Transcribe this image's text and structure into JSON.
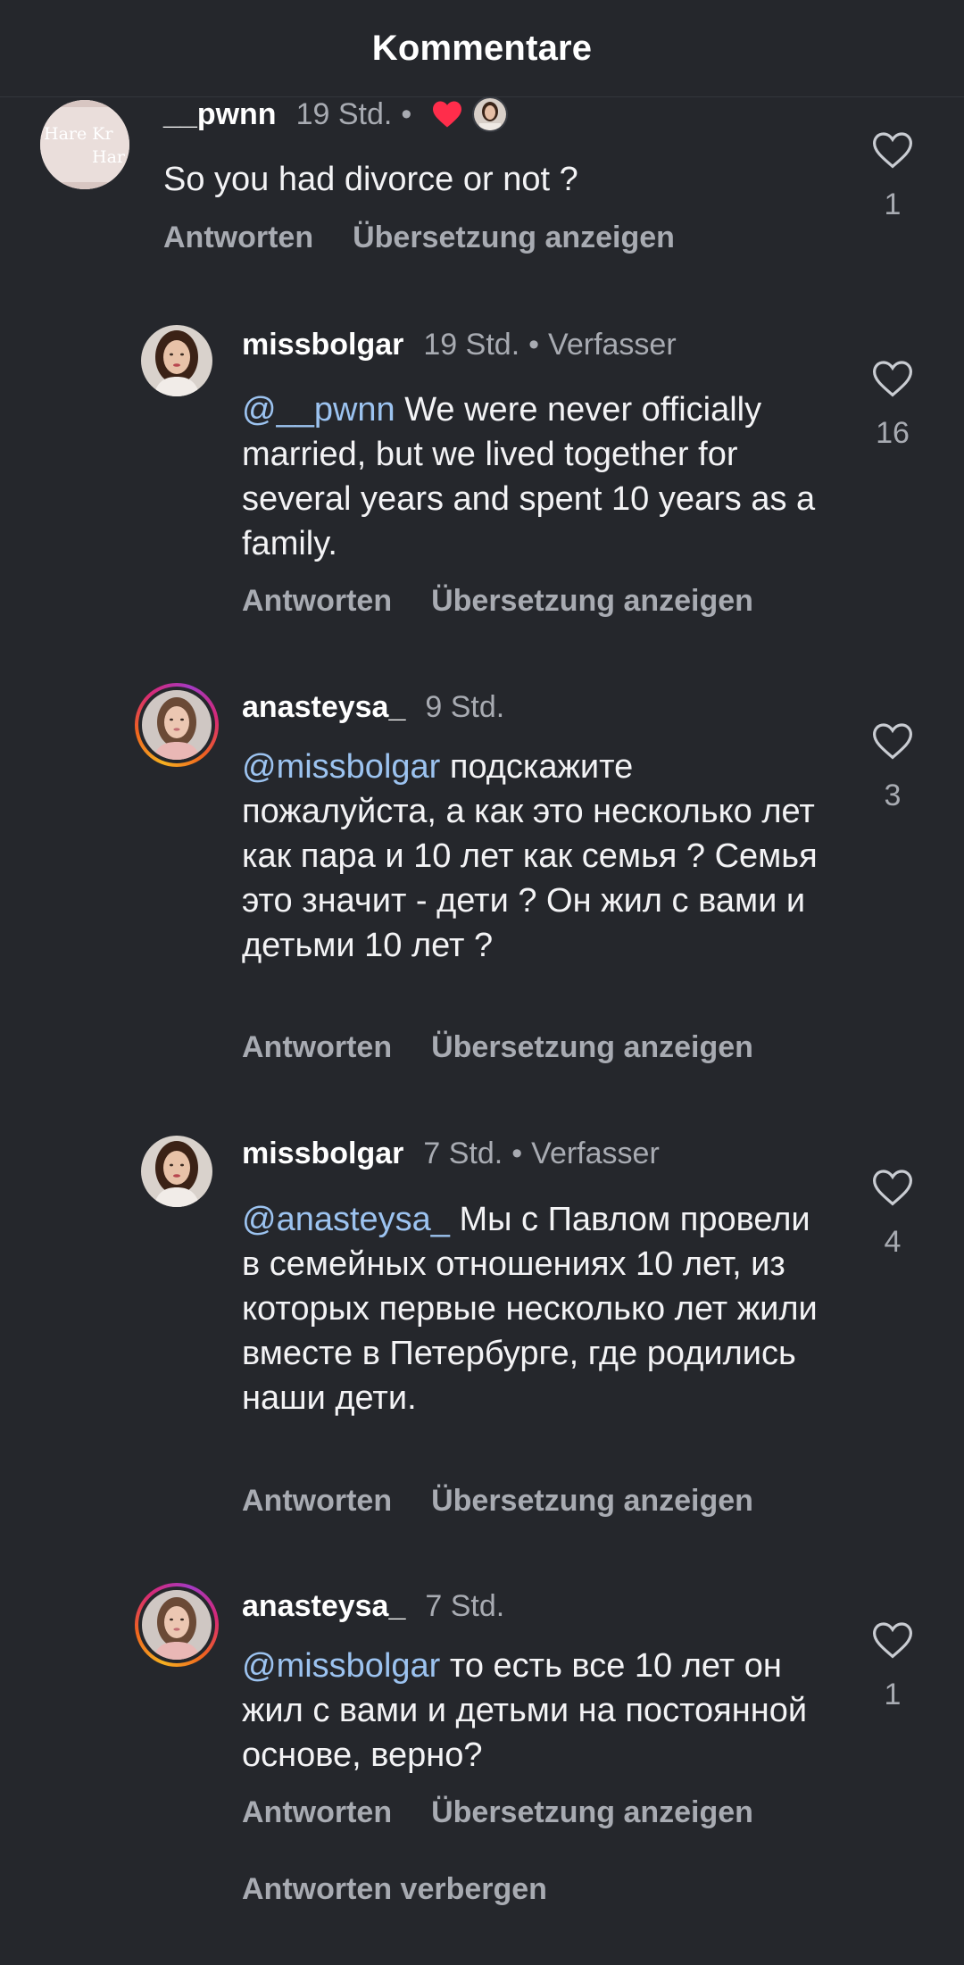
{
  "header": {
    "title": "Kommentare"
  },
  "comments": [
    {
      "username": "__pwnn",
      "time": "19 Std.",
      "author_tag": "",
      "mention": "",
      "text": "So you had divorce or not ?",
      "likes": "1",
      "reply_label": "Antworten",
      "translate_label": "Übersetzung anzeigen",
      "avatar_text": "Hare Kr Har",
      "liked_by_author": true
    },
    {
      "username": "missbolgar",
      "time": "19 Std.",
      "author_tag": "Verfasser",
      "mention": "@__pwnn",
      "text": " We were never officially married, but we lived together for several years and spent 10 years as a family.",
      "likes": "16",
      "reply_label": "Antworten",
      "translate_label": "Übersetzung anzeigen"
    },
    {
      "username": "anasteysa_",
      "time": "9 Std.",
      "author_tag": "",
      "mention": "@missbolgar",
      "text": " подскажите пожалуйста, а как это несколько лет как пара и 10 лет как семья ? Семья это значит - дети ? Он жил с вами и детьми 10 лет ?",
      "likes": "3",
      "reply_label": "Antworten",
      "translate_label": "Übersetzung anzeigen"
    },
    {
      "username": "missbolgar",
      "time": "7 Std.",
      "author_tag": "Verfasser",
      "mention": "@anasteysa_",
      "text": " Мы с Павлом провели в семейных отношениях 10 лет, из которых первые несколько лет жили вместе в Петербурге, где родились наши дети.",
      "likes": "4",
      "reply_label": "Antworten",
      "translate_label": "Übersetzung anzeigen"
    },
    {
      "username": "anasteysa_",
      "time": "7 Std.",
      "author_tag": "",
      "mention": "@missbolgar",
      "text": " то есть все 10 лет он жил с вами и детьми на постоянной основе, верно?",
      "likes": "1",
      "reply_label": "Antworten",
      "translate_label": "Übersetzung anzeigen"
    }
  ],
  "footer": {
    "hide_replies": "Antworten verbergen"
  },
  "colors": {
    "background": "#25272c",
    "mention": "#9cc3f0",
    "heart_red": "#ff2d4b",
    "story_ring": "#d62976"
  },
  "icons": [
    "heart-outline-icon",
    "red-heart-icon"
  ]
}
